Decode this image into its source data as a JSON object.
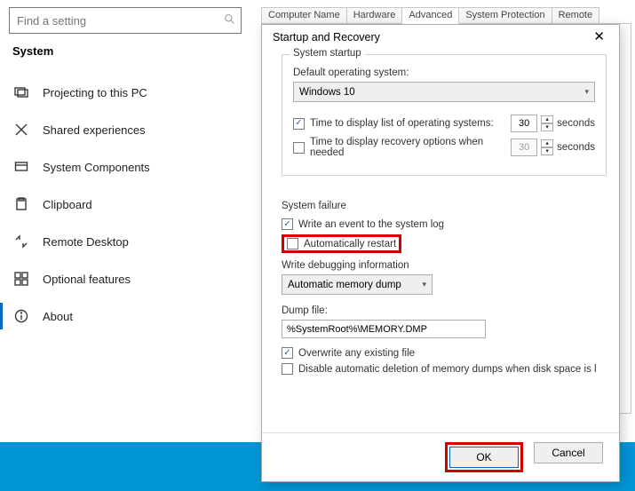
{
  "settings": {
    "search_placeholder": "Find a setting",
    "section_heading": "System",
    "nav": [
      {
        "key": "projecting",
        "label": "Projecting to this PC"
      },
      {
        "key": "shared",
        "label": "Shared experiences"
      },
      {
        "key": "components",
        "label": "System Components"
      },
      {
        "key": "clipboard",
        "label": "Clipboard"
      },
      {
        "key": "rdp",
        "label": "Remote Desktop"
      },
      {
        "key": "optional",
        "label": "Optional features"
      },
      {
        "key": "about",
        "label": "About"
      }
    ],
    "selected_nav": "about"
  },
  "tabs": {
    "items": [
      "Computer Name",
      "Hardware",
      "Advanced",
      "System Protection",
      "Remote"
    ],
    "active": "Advanced"
  },
  "dialog": {
    "title": "Startup and Recovery",
    "startup": {
      "group_title": "System startup",
      "default_os_label": "Default operating system:",
      "default_os_value": "Windows 10",
      "display_os_list_label": "Time to display list of operating systems:",
      "display_os_list_checked": true,
      "display_os_list_value": "30",
      "display_recovery_label": "Time to display recovery options when needed",
      "display_recovery_checked": false,
      "display_recovery_value": "30",
      "seconds": "seconds"
    },
    "failure": {
      "group_title": "System failure",
      "write_event_label": "Write an event to the system log",
      "write_event_checked": true,
      "auto_restart_label": "Automatically restart",
      "auto_restart_checked": false,
      "debug_label": "Write debugging information",
      "debug_value": "Automatic memory dump",
      "dump_file_label": "Dump file:",
      "dump_file_value": "%SystemRoot%\\MEMORY.DMP",
      "overwrite_label": "Overwrite any existing file",
      "overwrite_checked": true,
      "disable_delete_label": "Disable automatic deletion of memory dumps when disk space is l",
      "disable_delete_checked": false
    },
    "buttons": {
      "ok": "OK",
      "cancel": "Cancel"
    }
  }
}
